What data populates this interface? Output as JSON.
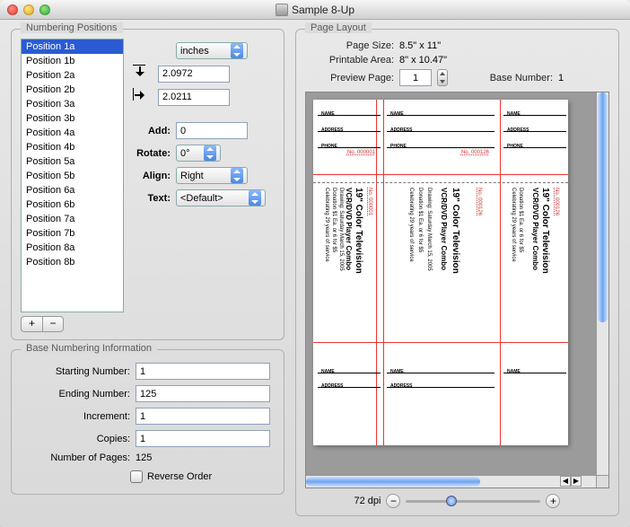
{
  "window_title": "Sample 8-Up",
  "groups": {
    "positions": "Numbering Positions",
    "base_info": "Base Numbering Information",
    "layout": "Page Layout"
  },
  "positions": {
    "items": [
      "Position 1a",
      "Position 1b",
      "Position 2a",
      "Position 2b",
      "Position 3a",
      "Position 3b",
      "Position 4a",
      "Position 4b",
      "Position 5a",
      "Position 5b",
      "Position 6a",
      "Position 6b",
      "Position 7a",
      "Position 7b",
      "Position 8a",
      "Position 8b"
    ],
    "selected_index": 0
  },
  "position_props": {
    "units": "inches",
    "x": "2.0972",
    "y": "2.0211",
    "add_label": "Add:",
    "add": "0",
    "rotate_label": "Rotate:",
    "rotate": "0°",
    "align_label": "Align:",
    "align": "Right",
    "text_label": "Text:",
    "text": "<Default>"
  },
  "base": {
    "start_label": "Starting Number:",
    "start": "1",
    "end_label": "Ending Number:",
    "end": "125",
    "inc_label": "Increment:",
    "inc": "1",
    "copies_label": "Copies:",
    "copies": "1",
    "pages_label": "Number of Pages:",
    "pages": "125",
    "reverse_label": "Reverse Order"
  },
  "layout": {
    "page_size_label": "Page Size:",
    "page_size": "8.5\" x 11\"",
    "printable_label": "Printable Area:",
    "printable": "8\" x 10.47\"",
    "preview_label": "Preview Page:",
    "preview_page": "1",
    "basenum_label": "Base Number:",
    "basenum": "1",
    "zoom": "72 dpi"
  },
  "ticket": {
    "name": "NAME",
    "address": "ADDRESS",
    "phone": "PHONE",
    "num1": "No. 000001",
    "num2": "No. 000126",
    "num3": "No. 000126",
    "title": "19\" Color Television",
    "sub": "VCR/DVD Player Combo",
    "drawing": "Drawing: Saturday March 15, 2005",
    "donation": "Donation $1 Ea. or 6 for $5",
    "celebrate": "Celebrating 29 years of service"
  }
}
